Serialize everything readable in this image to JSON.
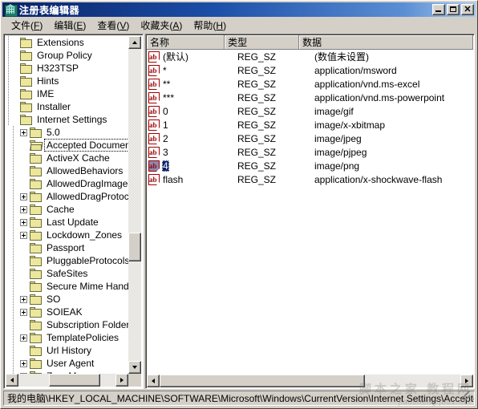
{
  "window": {
    "title": "注册表编辑器",
    "icon": "registry-editor-icon",
    "buttons": {
      "minimize": "_",
      "maximize": "□",
      "close": "✕"
    }
  },
  "menubar": {
    "items": [
      {
        "label": "文件",
        "accel": "F"
      },
      {
        "label": "编辑",
        "accel": "E"
      },
      {
        "label": "查看",
        "accel": "V"
      },
      {
        "label": "收藏夹",
        "accel": "A"
      },
      {
        "label": "帮助",
        "accel": "H"
      }
    ]
  },
  "tree": {
    "nodes": [
      {
        "label": "Extensions",
        "depth": 0,
        "expander": "none",
        "selected": false,
        "open": false
      },
      {
        "label": "Group Policy",
        "depth": 0,
        "expander": "none",
        "selected": false,
        "open": false
      },
      {
        "label": "H323TSP",
        "depth": 0,
        "expander": "none",
        "selected": false,
        "open": false
      },
      {
        "label": "Hints",
        "depth": 0,
        "expander": "none",
        "selected": false,
        "open": false
      },
      {
        "label": "IME",
        "depth": 0,
        "expander": "none",
        "selected": false,
        "open": false
      },
      {
        "label": "Installer",
        "depth": 0,
        "expander": "none",
        "selected": false,
        "open": false
      },
      {
        "label": "Internet Settings",
        "depth": 0,
        "expander": "none",
        "selected": false,
        "open": false
      },
      {
        "label": "5.0",
        "depth": 1,
        "expander": "plus",
        "selected": false,
        "open": false
      },
      {
        "label": "Accepted Documents",
        "depth": 1,
        "expander": "none",
        "selected": true,
        "open": true
      },
      {
        "label": "ActiveX Cache",
        "depth": 1,
        "expander": "none",
        "selected": false,
        "open": false
      },
      {
        "label": "AllowedBehaviors",
        "depth": 1,
        "expander": "none",
        "selected": false,
        "open": false
      },
      {
        "label": "AllowedDragImageExt",
        "depth": 1,
        "expander": "none",
        "selected": false,
        "open": false
      },
      {
        "label": "AllowedDragProtocols",
        "depth": 1,
        "expander": "plus",
        "selected": false,
        "open": false
      },
      {
        "label": "Cache",
        "depth": 1,
        "expander": "plus",
        "selected": false,
        "open": false
      },
      {
        "label": "Last Update",
        "depth": 1,
        "expander": "plus",
        "selected": false,
        "open": false
      },
      {
        "label": "Lockdown_Zones",
        "depth": 1,
        "expander": "plus",
        "selected": false,
        "open": false
      },
      {
        "label": "Passport",
        "depth": 1,
        "expander": "none",
        "selected": false,
        "open": false
      },
      {
        "label": "PluggableProtocols",
        "depth": 1,
        "expander": "none",
        "selected": false,
        "open": false
      },
      {
        "label": "SafeSites",
        "depth": 1,
        "expander": "none",
        "selected": false,
        "open": false
      },
      {
        "label": "Secure Mime Handlers",
        "depth": 1,
        "expander": "none",
        "selected": false,
        "open": false
      },
      {
        "label": "SO",
        "depth": 1,
        "expander": "plus",
        "selected": false,
        "open": false
      },
      {
        "label": "SOIEAK",
        "depth": 1,
        "expander": "plus",
        "selected": false,
        "open": false
      },
      {
        "label": "Subscription Folder",
        "depth": 1,
        "expander": "none",
        "selected": false,
        "open": false
      },
      {
        "label": "TemplatePolicies",
        "depth": 1,
        "expander": "plus",
        "selected": false,
        "open": false
      },
      {
        "label": "Url History",
        "depth": 1,
        "expander": "none",
        "selected": false,
        "open": false
      },
      {
        "label": "User Agent",
        "depth": 1,
        "expander": "plus",
        "selected": false,
        "open": false
      },
      {
        "label": "ZoneMap",
        "depth": 1,
        "expander": "plus",
        "selected": false,
        "open": false
      }
    ]
  },
  "list": {
    "columns": [
      "名称",
      "类型",
      "数据"
    ],
    "rows": [
      {
        "name": "(默认)",
        "type": "REG_SZ",
        "data": "(数值未设置)",
        "selected": false
      },
      {
        "name": "*",
        "type": "REG_SZ",
        "data": "application/msword",
        "selected": false
      },
      {
        "name": "**",
        "type": "REG_SZ",
        "data": "application/vnd.ms-excel",
        "selected": false
      },
      {
        "name": "***",
        "type": "REG_SZ",
        "data": "application/vnd.ms-powerpoint",
        "selected": false
      },
      {
        "name": "0",
        "type": "REG_SZ",
        "data": "image/gif",
        "selected": false
      },
      {
        "name": "1",
        "type": "REG_SZ",
        "data": "image/x-xbitmap",
        "selected": false
      },
      {
        "name": "2",
        "type": "REG_SZ",
        "data": "image/jpeg",
        "selected": false
      },
      {
        "name": "3",
        "type": "REG_SZ",
        "data": "image/pjpeg",
        "selected": false
      },
      {
        "name": "4",
        "type": "REG_SZ",
        "data": "image/png",
        "selected": true
      },
      {
        "name": "flash",
        "type": "REG_SZ",
        "data": "application/x-shockwave-flash",
        "selected": false
      }
    ]
  },
  "statusbar": {
    "path": "我的电脑\\HKEY_LOCAL_MACHINE\\SOFTWARE\\Microsoft\\Windows\\CurrentVersion\\Internet Settings\\Accepted Documents"
  },
  "watermark": {
    "line1": "脚本之家 教程网",
    "line2": "jiaocheng.jb51.net"
  },
  "colors": {
    "title_active": "#0a246a",
    "face": "#d4d0c8",
    "selection": "#0a246a",
    "folder": "#ece79c",
    "icon_text": "#9a0000"
  }
}
